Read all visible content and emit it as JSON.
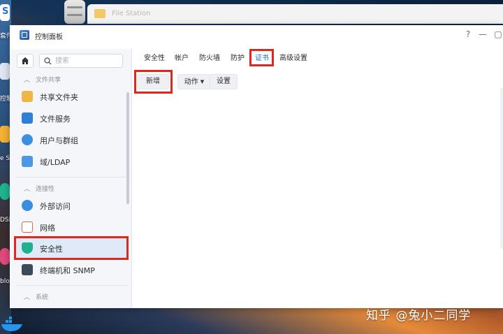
{
  "desktop": {
    "side_labels": [
      "套件",
      "控制",
      "e S",
      "DSM",
      "blog"
    ],
    "watermark": "知乎 @兔小二同学"
  },
  "file_station": {
    "title": "File Station"
  },
  "window": {
    "title": "控制面板",
    "controls": {
      "help": "?",
      "minimize": "—",
      "maximize": "▢"
    }
  },
  "sidebar": {
    "search_placeholder": "搜索",
    "sections": [
      {
        "label": "文件共享"
      },
      {
        "label": "连接性"
      },
      {
        "label": "系统"
      }
    ],
    "items": [
      {
        "label": "共享文件夹",
        "icon": "shared-folder-icon"
      },
      {
        "label": "文件服务",
        "icon": "file-services-icon"
      },
      {
        "label": "用户与群组",
        "icon": "users-groups-icon"
      },
      {
        "label": "域/LDAP",
        "icon": "domain-ldap-icon"
      },
      {
        "label": "外部访问",
        "icon": "external-access-icon"
      },
      {
        "label": "网络",
        "icon": "network-icon"
      },
      {
        "label": "安全性",
        "icon": "security-shield-icon",
        "active": true
      },
      {
        "label": "终端机和 SNMP",
        "icon": "terminal-icon"
      }
    ]
  },
  "tabs": [
    {
      "label": "安全性"
    },
    {
      "label": "帐户"
    },
    {
      "label": "防火墙"
    },
    {
      "label": "防护"
    },
    {
      "label": "证书",
      "active": true
    },
    {
      "label": "高级设置"
    }
  ],
  "toolbar": {
    "add": "新增",
    "action": "动作",
    "settings": "设置"
  },
  "colors": {
    "accent": "#1a73d1",
    "highlight_box": "#e0271d",
    "active_nav": "#dfe9f7"
  }
}
